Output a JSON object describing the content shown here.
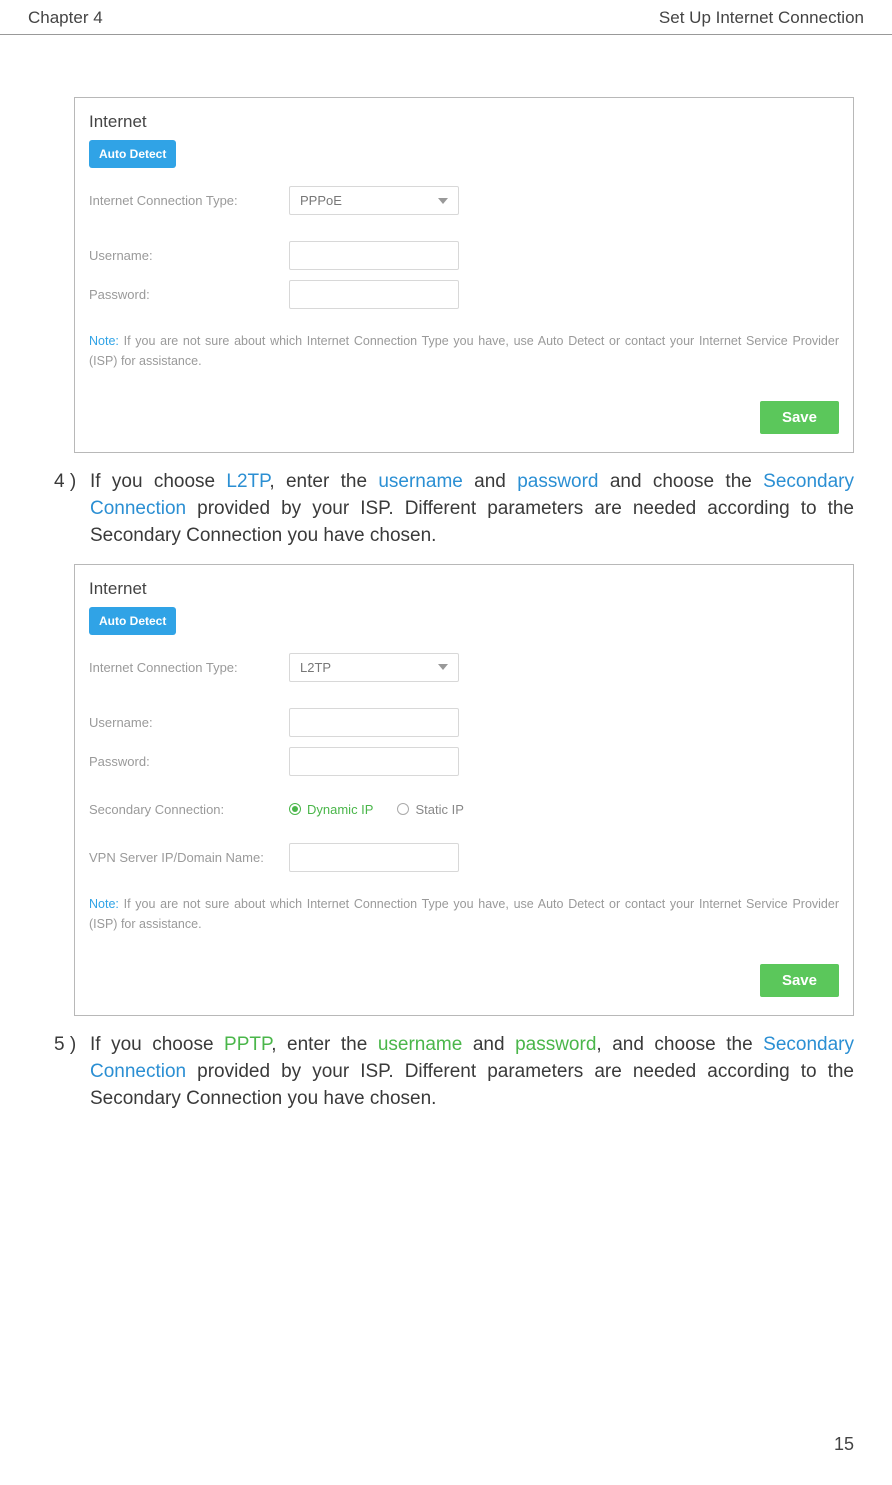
{
  "header": {
    "chapter": "Chapter 4",
    "title": "Set Up Internet Connection"
  },
  "panel1": {
    "title": "Internet",
    "auto_detect": "Auto Detect",
    "conn_type_label": "Internet Connection Type:",
    "conn_type_value": "PPPoE",
    "username_label": "Username:",
    "password_label": "Password:",
    "note_label": "Note:",
    "note_text": " If you are not sure about which Internet Connection Type you have, use Auto Detect or contact your Internet Service Provider (ISP) for assistance.",
    "save": "Save"
  },
  "step4": {
    "num": "4 )",
    "t1": "If you choose ",
    "hl1": "L2TP",
    "t2": ", enter the ",
    "hl2": "username",
    "t3": " and ",
    "hl3": "password",
    "t4": " and choose the ",
    "hl4": "Secondary Connection",
    "t5": " provided by your ISP. Different parameters are needed according to the Secondary Connection you have chosen."
  },
  "panel2": {
    "title": "Internet",
    "auto_detect": "Auto Detect",
    "conn_type_label": "Internet Connection Type:",
    "conn_type_value": "L2TP",
    "username_label": "Username:",
    "password_label": "Password:",
    "secondary_label": "Secondary Connection:",
    "radio_dynamic": "Dynamic IP",
    "radio_static": "Static IP",
    "vpn_label": "VPN Server IP/Domain Name:",
    "note_label": "Note:",
    "note_text": " If you are not sure about which Internet Connection Type you have, use Auto Detect or contact your Internet Service Provider (ISP) for assistance.",
    "save": "Save"
  },
  "step5": {
    "num": "5 )",
    "t1": "If you choose ",
    "hl1": "PPTP",
    "t2": ", enter the ",
    "hl2": "username",
    "t3": " and ",
    "hl3": "password",
    "t4": ", and choose the ",
    "hl4": "Secondary Connection",
    "t5": " provided by your ISP. Different parameters are needed according to the Secondary Connection you have chosen."
  },
  "page_number": "15"
}
